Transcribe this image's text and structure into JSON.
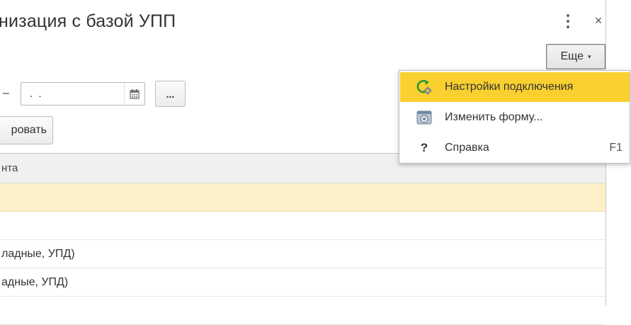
{
  "window": {
    "title": "низация с базой УПП",
    "more_icon": "vertical-dots-icon",
    "close_icon": "close-icon",
    "close_glyph": "×"
  },
  "toolbar": {
    "more_button_label": "Еще",
    "more_button_arrow": "▾"
  },
  "filter": {
    "dash": "–",
    "date_value": ". .",
    "calendar_icon": "calendar-icon",
    "select_button_label": "...",
    "action_button_label": "ровать"
  },
  "table": {
    "header": "нта",
    "rows": [
      {
        "text": "",
        "selected": true
      },
      {
        "text": "",
        "selected": false
      },
      {
        "text": "ладные, УПД)",
        "selected": false
      },
      {
        "text": "адные, УПД)",
        "selected": false
      },
      {
        "text": "",
        "selected": false
      }
    ]
  },
  "menu": {
    "items": [
      {
        "label": "Настройки подключения",
        "icon": "refresh-settings-icon",
        "shortcut": "",
        "active": true
      },
      {
        "label": "Изменить форму...",
        "icon": "form-settings-icon",
        "shortcut": "",
        "active": false
      },
      {
        "label": "Справка",
        "icon": "help-icon",
        "shortcut": "F1",
        "active": false
      }
    ]
  },
  "colors": {
    "menu_highlight": "#f9d030",
    "row_selected": "#fbf0c8",
    "header_bg": "#f0f0f0"
  }
}
